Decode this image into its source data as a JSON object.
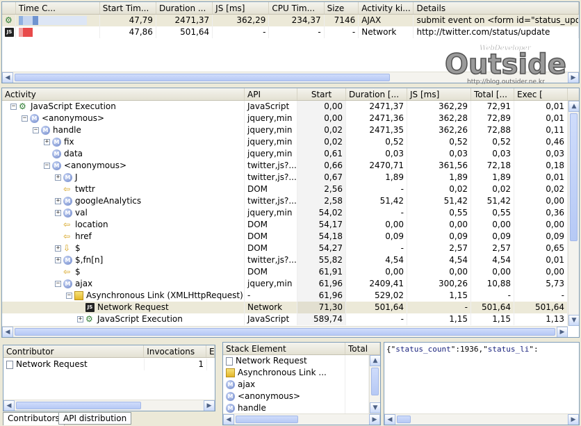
{
  "top_table": {
    "columns": [
      "Time C...",
      "Start Tim...",
      "Duration ...",
      "JS [ms]",
      "CPU Tim...",
      "Size",
      "Activity ki...",
      "Details"
    ],
    "rows": [
      {
        "start": "47,79",
        "duration": "2471,37",
        "js": "362,29",
        "cpu": "234,37",
        "size": "7146",
        "kind": "AJAX",
        "details": "submit event on <form id=\"status_update..."
      },
      {
        "start": "47,86",
        "duration": "501,64",
        "js": "-",
        "cpu": "-",
        "size": "-",
        "kind": "Network",
        "details": "http://twitter.com/status/update"
      }
    ]
  },
  "watermark": {
    "small": "WebDeveloper",
    "big": "Outsider",
    "url": "http://blog.outsider.ne.kr"
  },
  "tree_table": {
    "columns": [
      "Activity",
      "API",
      "Start",
      "Duration [...",
      "JS [ms]",
      "Total [...",
      "Exec ["
    ],
    "rows": [
      {
        "indent": 0,
        "tog": "−",
        "icon": "gear",
        "name": "JavaScript Execution",
        "api": "JavaScript",
        "start": "0,00",
        "duration": "2471,37",
        "js": "362,29",
        "total": "72,91",
        "exec": "0,01"
      },
      {
        "indent": 1,
        "tog": "−",
        "icon": "m",
        "name": "<anonymous>",
        "api": "jquery,min",
        "start": "0,00",
        "duration": "2471,36",
        "js": "362,28",
        "total": "72,89",
        "exec": "0,01"
      },
      {
        "indent": 2,
        "tog": "−",
        "icon": "m",
        "name": "handle",
        "api": "jquery,min",
        "start": "0,02",
        "duration": "2471,35",
        "js": "362,26",
        "total": "72,88",
        "exec": "0,11"
      },
      {
        "indent": 3,
        "tog": "+",
        "icon": "m",
        "name": "fix",
        "api": "jquery,min",
        "start": "0,02",
        "duration": "0,52",
        "js": "0,52",
        "total": "0,52",
        "exec": "0,46"
      },
      {
        "indent": 3,
        "tog": "",
        "icon": "m",
        "name": "data",
        "api": "jquery,min",
        "start": "0,61",
        "duration": "0,03",
        "js": "0,03",
        "total": "0,03",
        "exec": "0,03"
      },
      {
        "indent": 3,
        "tog": "−",
        "icon": "m",
        "name": "<anonymous>",
        "api": "twitter,js?...",
        "start": "0,66",
        "duration": "2470,71",
        "js": "361,56",
        "total": "72,18",
        "exec": "0,18"
      },
      {
        "indent": 4,
        "tog": "+",
        "icon": "m",
        "name": "J",
        "api": "twitter,js?...",
        "start": "0,67",
        "duration": "1,89",
        "js": "1,89",
        "total": "1,89",
        "exec": "0,01"
      },
      {
        "indent": 4,
        "tog": "",
        "icon": "arrow-left",
        "name": "twttr",
        "api": "DOM",
        "start": "2,56",
        "duration": "-",
        "js": "0,02",
        "total": "0,02",
        "exec": "0,02"
      },
      {
        "indent": 4,
        "tog": "+",
        "icon": "m",
        "name": "googleAnalytics",
        "api": "twitter,js?...",
        "start": "2,58",
        "duration": "51,42",
        "js": "51,42",
        "total": "51,42",
        "exec": "0,00"
      },
      {
        "indent": 4,
        "tog": "+",
        "icon": "m",
        "name": "val",
        "api": "jquery,min",
        "start": "54,02",
        "duration": "-",
        "js": "0,55",
        "total": "0,55",
        "exec": "0,36"
      },
      {
        "indent": 4,
        "tog": "",
        "icon": "arrow-left",
        "name": "location",
        "api": "DOM",
        "start": "54,17",
        "duration": "0,00",
        "js": "0,00",
        "total": "0,00",
        "exec": "0,00"
      },
      {
        "indent": 4,
        "tog": "",
        "icon": "arrow-left",
        "name": "href",
        "api": "DOM",
        "start": "54,18",
        "duration": "0,09",
        "js": "0,09",
        "total": "0,09",
        "exec": "0,09"
      },
      {
        "indent": 4,
        "tog": "+",
        "icon": "arrow-down",
        "name": "$",
        "api": "DOM",
        "start": "54,27",
        "duration": "-",
        "js": "2,57",
        "total": "2,57",
        "exec": "0,65"
      },
      {
        "indent": 4,
        "tog": "+",
        "icon": "m",
        "name": "$,fn[n]",
        "api": "twitter,js?...",
        "start": "55,82",
        "duration": "4,54",
        "js": "4,54",
        "total": "4,54",
        "exec": "0,01"
      },
      {
        "indent": 4,
        "tog": "",
        "icon": "arrow-left",
        "name": "$",
        "api": "DOM",
        "start": "61,91",
        "duration": "0,00",
        "js": "0,00",
        "total": "0,00",
        "exec": "0,00"
      },
      {
        "indent": 4,
        "tog": "−",
        "icon": "m",
        "name": "ajax",
        "api": "jquery,min",
        "start": "61,96",
        "duration": "2409,41",
        "js": "300,26",
        "total": "10,88",
        "exec": "5,73"
      },
      {
        "indent": 5,
        "tog": "−",
        "icon": "link",
        "name": "Asynchronous Link (XMLHttpRequest)",
        "api": "-",
        "start": "61,96",
        "duration": "529,02",
        "js": "1,15",
        "total": "-",
        "exec": "-"
      },
      {
        "indent": 6,
        "tog": "",
        "icon": "js",
        "name": "Network Request",
        "api": "Network",
        "start": "71,30",
        "duration": "501,64",
        "js": "-",
        "total": "501,64",
        "exec": "501,64",
        "selected": true
      },
      {
        "indent": 6,
        "tog": "+",
        "icon": "gear",
        "name": "JavaScript Execution",
        "api": "JavaScript",
        "start": "589,74",
        "duration": "-",
        "js": "1,15",
        "total": "1,15",
        "exec": "1,13"
      }
    ]
  },
  "contributors": {
    "columns": [
      "Contributor",
      "Invocations",
      "E"
    ],
    "rows": [
      {
        "name": "Network Request",
        "invocations": "1"
      }
    ],
    "tabs": [
      "Contributors",
      "API distribution"
    ]
  },
  "stack": {
    "columns": [
      "Stack Element",
      "Total"
    ],
    "rows": [
      {
        "icon": "doc",
        "name": "Network Request"
      },
      {
        "icon": "link",
        "name": "Asynchronous Link ..."
      },
      {
        "icon": "m",
        "name": "ajax"
      },
      {
        "icon": "m",
        "name": "<anonymous>"
      },
      {
        "icon": "m",
        "name": "handle"
      }
    ]
  },
  "response": {
    "text_parts": [
      "{\"",
      "status_count",
      "\":1936,\"",
      "status_li",
      "\":"
    ]
  }
}
